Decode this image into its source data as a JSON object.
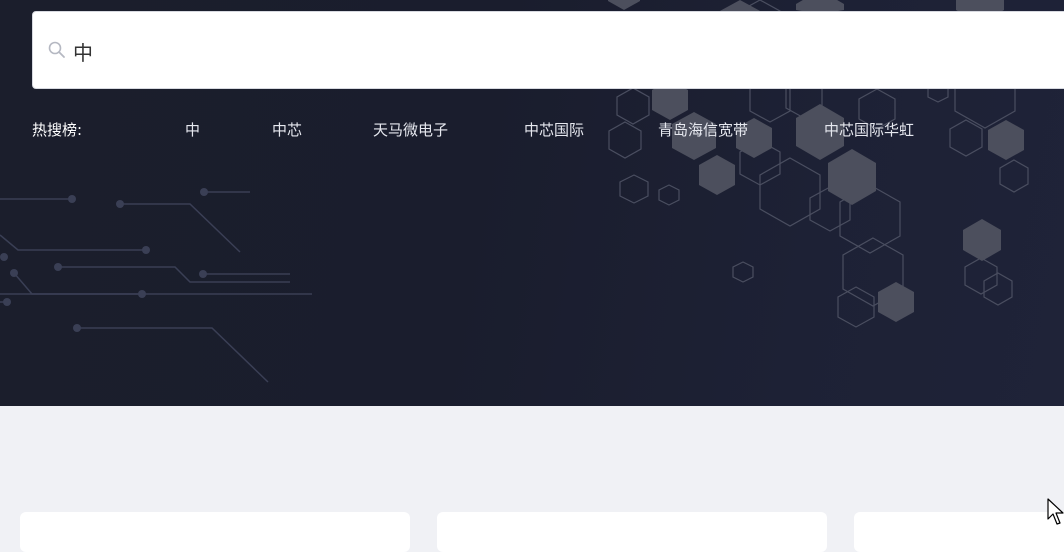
{
  "search": {
    "value": "中",
    "icon": "search-icon"
  },
  "hot": {
    "label": "热搜榜:",
    "items": [
      {
        "label": "中"
      },
      {
        "label": "中芯"
      },
      {
        "label": "天马微电子"
      },
      {
        "label": "中芯国际"
      },
      {
        "label": "青岛海信宽带"
      },
      {
        "label": "中芯国际华虹"
      }
    ]
  },
  "colors": {
    "hero_bg": "#1b1e2c",
    "page_bg": "#f0f1f5",
    "card_bg": "#ffffff"
  }
}
